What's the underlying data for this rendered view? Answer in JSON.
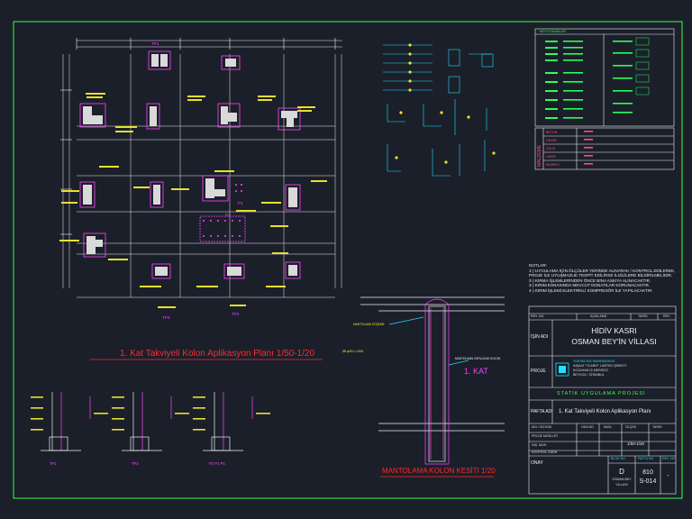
{
  "drawing": {
    "plan_title": "1. Kat Takviyeli Kolon Aplikasyon Planı  1/50-1/20",
    "section_title": "MANTOLAMA KOLON KESİTİ  1/20",
    "floor_label": "1. KAT",
    "section_callouts": {
      "left": "MANTOLAMA DÖŞEME",
      "right": "MANTOLAMA YAPILACAK KOLON"
    },
    "column_tags": [
      "TP1",
      "TP2",
      "TP3",
      "TP1",
      "TP2",
      "P1",
      "P2"
    ],
    "detail_labels": [
      "TP1",
      "TP3",
      "P2 P3 P4"
    ],
    "note_small": "Ø8 φ/50 L=1500"
  },
  "notes": {
    "heading": "NOTLAR:",
    "lines": [
      "1-) UYGULAMA İÇİN ÖLÇÜLER YERİNDE ALINARAK / KONTROL EDİLEREK,",
      "PROJE İLE UYUŞMAZLIK TESPİT EDİLİRSE İLGİLİLERE BİLDİRİLMELİDİR.",
      "2-) KIRMA İŞLEMLERİNDEN ÖNCE BİNA ASKIYA ALINACAKTIR.",
      "3-) KIRIM ESNASINDA MEVCUT DONATILAR KORUNACAKTIR.",
      "4-) KIRIM İŞLEMİ ELEKTRİKLİ KOMPRESÖR İLE YAPILACAKTIR."
    ]
  },
  "legend": {
    "title": "YAPI ELEMANLARI",
    "materials_heading": "MALZEME",
    "materials": [
      "BETON",
      "DEMİR",
      "ÇELİK",
      "HASIR",
      "PASPAYI"
    ]
  },
  "title_block": {
    "revision_row": [
      "REV. NO",
      "AÇIKLAMA",
      "TARİH",
      "REV."
    ],
    "job_label": "İŞİN ADI",
    "job_line1": "HİDİV KASRI",
    "job_line2": "OSMAN BEY'İN VİLLASI",
    "project_label": "PROJE",
    "company_lines": [
      "YÜKSELTEK MÜHENDİSLİK",
      "İNŞAAT TİCARET LİMİTED ŞİRKETİ",
      "KOZAHAN İŞ MERKEZİ",
      "BEYKOZ / İSTANBUL"
    ],
    "subtitle": "STATİK UYGULAMA PROJESİ",
    "sheet_label": "PAFTA ADI",
    "sheet_name": "1. Kat Takviyeli Kolon Aplikasyon Planı",
    "table_headers": [
      "ADI / SOYADI",
      "ODA NO",
      "İMZA",
      "ÖLÇEK",
      "TARİH"
    ],
    "rows": [
      "PROJE MÜELLİFİ",
      "İNŞ. MÜH.",
      "KONTROL EDEN"
    ],
    "scale": "1/50-1/20",
    "approval_label": "ONAY",
    "block_label": "BLOK NO",
    "block_value": "D",
    "block_sub": "OSMAN BEY",
    "block_sub2": "VİLLASI",
    "sheet_no_label": "PAFTA NO",
    "sheet_no": "810",
    "sheet_code": "S-014",
    "rev_label": "REV. NO",
    "rev_value": "-"
  },
  "colors": {
    "background": "#1b1f2a",
    "column_fill": "#d9d9d9",
    "rebar": "#ff44ff",
    "dimension": "#ffffff",
    "annotation": "#e8e030",
    "callout": "#20e0ff",
    "frame": "#39ff4a"
  }
}
